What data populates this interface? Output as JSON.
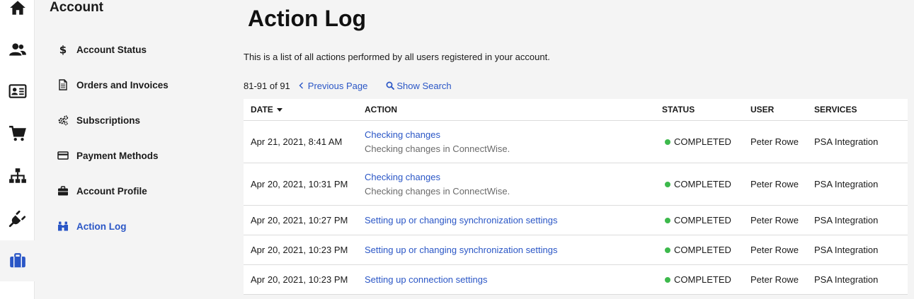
{
  "rail": {
    "items": [
      {
        "icon": "home-icon"
      },
      {
        "icon": "users-icon"
      },
      {
        "icon": "contact-card-icon"
      },
      {
        "icon": "cart-icon"
      },
      {
        "icon": "hierarchy-icon"
      },
      {
        "icon": "plug-icon"
      },
      {
        "icon": "briefcase-icon",
        "active": true
      }
    ],
    "active_color": "#2a56c6"
  },
  "subnav": {
    "title": "Account",
    "items": [
      {
        "label": "Account Status",
        "icon": "dollar-icon"
      },
      {
        "label": "Orders and Invoices",
        "icon": "document-icon"
      },
      {
        "label": "Subscriptions",
        "icon": "gears-icon"
      },
      {
        "label": "Payment Methods",
        "icon": "credit-card-icon"
      },
      {
        "label": "Account Profile",
        "icon": "briefcase-icon"
      },
      {
        "label": "Action Log",
        "icon": "binoculars-icon",
        "active": true
      }
    ]
  },
  "main": {
    "title": "Action Log",
    "description": "This is a list of all actions performed by all users registered in your account.",
    "pager": {
      "range": "81-91 of 91",
      "previous_label": "Previous Page",
      "search_label": "Show Search"
    },
    "table": {
      "columns": [
        "DATE",
        "ACTION",
        "STATUS",
        "USER",
        "SERVICES"
      ],
      "rows": [
        {
          "date": "Apr 21, 2021, 8:41 AM",
          "action": "Checking changes",
          "detail": "Checking changes in ConnectWise.",
          "status": "COMPLETED",
          "user": "Peter Rowe",
          "service": "PSA Integration"
        },
        {
          "date": "Apr 20, 2021, 10:31 PM",
          "action": "Checking changes",
          "detail": "Checking changes in ConnectWise.",
          "status": "COMPLETED",
          "user": "Peter Rowe",
          "service": "PSA Integration"
        },
        {
          "date": "Apr 20, 2021, 10:27 PM",
          "action": "Setting up or changing synchronization settings",
          "detail": "",
          "status": "COMPLETED",
          "user": "Peter Rowe",
          "service": "PSA Integration"
        },
        {
          "date": "Apr 20, 2021, 10:23 PM",
          "action": "Setting up or changing synchronization settings",
          "detail": "",
          "status": "COMPLETED",
          "user": "Peter Rowe",
          "service": "PSA Integration"
        },
        {
          "date": "Apr 20, 2021, 10:23 PM",
          "action": "Setting up connection settings",
          "detail": "",
          "status": "COMPLETED",
          "user": "Peter Rowe",
          "service": "PSA Integration"
        }
      ]
    },
    "colors": {
      "link": "#2a56c6",
      "status_completed": "#3db94c"
    }
  }
}
